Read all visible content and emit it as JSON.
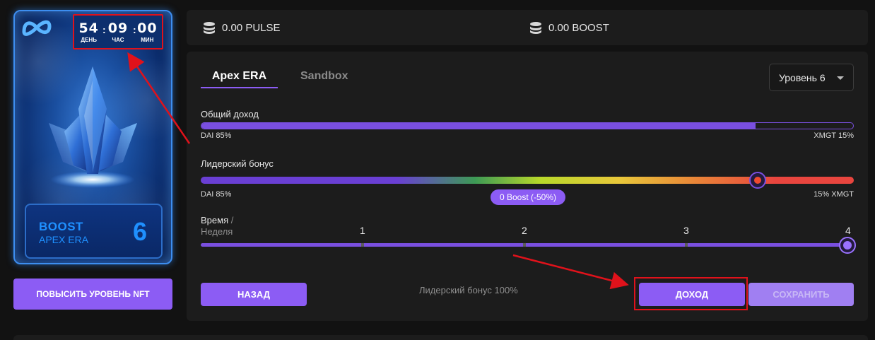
{
  "timer": {
    "days": "54",
    "days_label": "ДЕНЬ",
    "hours": "09",
    "hours_label": "ЧАС",
    "minutes": "00",
    "minutes_label": "МИН"
  },
  "card": {
    "title": "BOOST",
    "subtitle": "APEX ERA",
    "level": "6",
    "logo_icon": "meta-infinity-icon",
    "image": "blue-crystal"
  },
  "upgrade_button": "ПОВЫСИТЬ УРОВЕНЬ NFT",
  "balances": {
    "pulse": "0.00 PULSE",
    "boost": "0.00 BOOST",
    "icon": "coins-stack-icon"
  },
  "tabs": [
    {
      "label": "Apex ERA",
      "active": true
    },
    {
      "label": "Sandbox",
      "active": false
    }
  ],
  "level_select": {
    "value": "Уровень 6"
  },
  "income": {
    "label": "Общий доход",
    "left": "DAI 85%",
    "right": "XMGT 15%",
    "fill": 0.85
  },
  "leader": {
    "label": "Лидерский бонус",
    "left": "DAI 85%",
    "right": "15% XMGT",
    "pill": "0 Boost (-50%)",
    "value": 0.85
  },
  "time": {
    "label": "Время",
    "slash": "/",
    "unit": "Неделя",
    "steps": [
      "1",
      "2",
      "3",
      "4"
    ],
    "value": 4
  },
  "buttons": {
    "back": "НАЗАД",
    "income": "ДОХОД",
    "save": "СОХРАНИТЬ"
  },
  "leader_note": "Лидерский бонус 100%",
  "colors": {
    "accent": "#8c5cf4",
    "annotation": "#e0121b",
    "panel": "#1c1c1c",
    "background": "#121212"
  }
}
